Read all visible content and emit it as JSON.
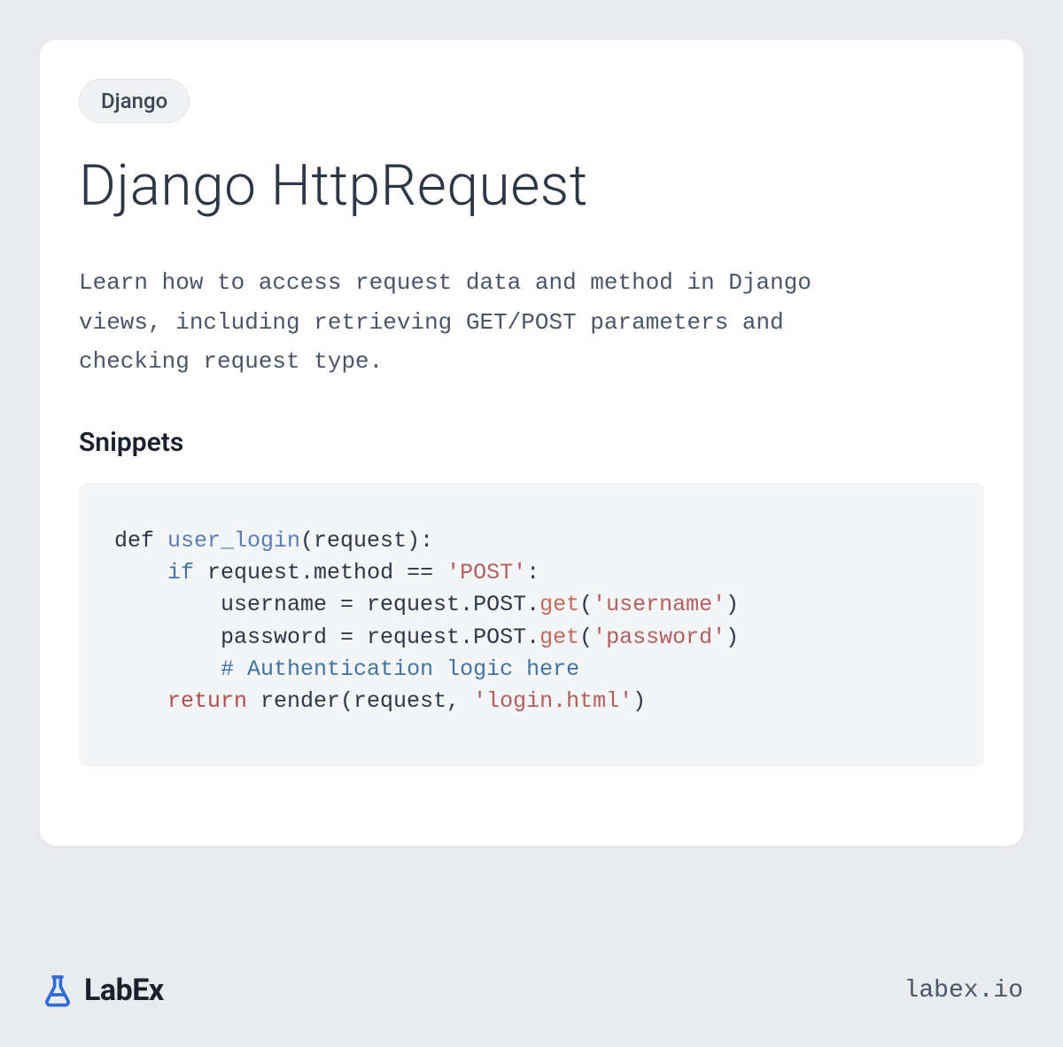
{
  "tag": "Django",
  "title": "Django HttpRequest",
  "description": "Learn how to access request data and method in Django views, including retrieving GET/POST parameters and checking request type.",
  "snippets_heading": "Snippets",
  "code": {
    "l1_a": "def ",
    "l1_fn": "user_login",
    "l1_b": "(request):",
    "l2_a": "    ",
    "l2_kw": "if",
    "l2_b": " request.method == ",
    "l2_str": "'POST'",
    "l2_c": ":",
    "l3_a": "        username = request.POST.",
    "l3_m": "get",
    "l3_b": "(",
    "l3_str": "'username'",
    "l3_c": ")",
    "l4_a": "        password = request.POST.",
    "l4_m": "get",
    "l4_b": "(",
    "l4_str": "'password'",
    "l4_c": ")",
    "l5_a": "        ",
    "l5_comment": "# Authentication logic here",
    "l6_a": "    ",
    "l6_ret": "return",
    "l6_b": " render(request, ",
    "l6_str": "'login.html'",
    "l6_c": ")"
  },
  "brand": "LabEx",
  "footer_url": "labex.io"
}
